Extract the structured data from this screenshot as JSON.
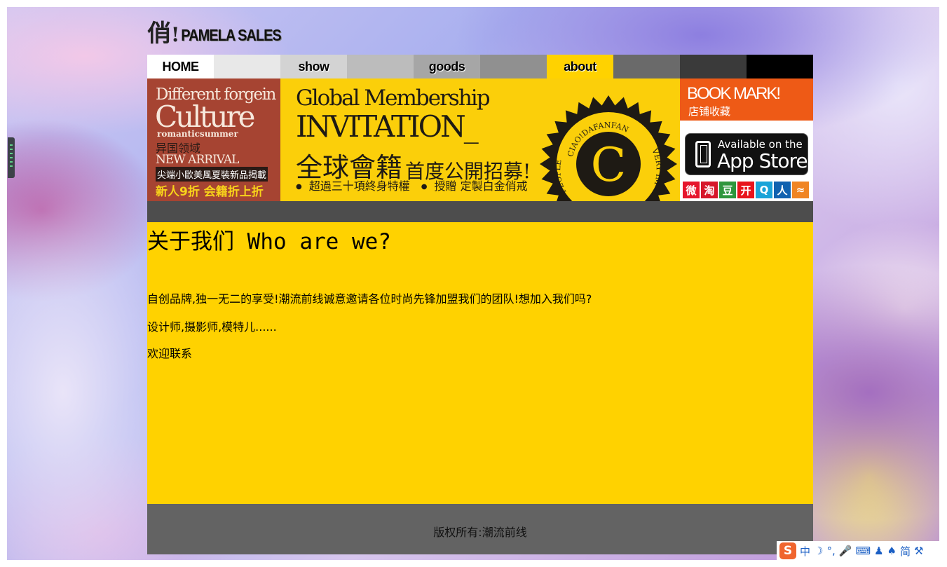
{
  "logo": {
    "char": "俏",
    "bang": "!",
    "text": "PAMELA SALES"
  },
  "nav": {
    "items": [
      {
        "label": "HOME",
        "bg": "#ffffff"
      },
      {
        "label": "",
        "bg": "#e8e8e8"
      },
      {
        "label": "show",
        "bg": "#d3d3d3"
      },
      {
        "label": "",
        "bg": "#bcbcbc"
      },
      {
        "label": "goods",
        "bg": "#a6a6a6"
      },
      {
        "label": "",
        "bg": "#909090"
      },
      {
        "label": "about",
        "bg": "#ffd200"
      },
      {
        "label": "",
        "bg": "#6a6a6a"
      },
      {
        "label": "",
        "bg": "#3a3a3a"
      },
      {
        "label": "",
        "bg": "#000000"
      }
    ]
  },
  "banner": {
    "left": {
      "line1": "Different forgein",
      "line2": "Culture",
      "line3": "romanticsummer",
      "line4": "异国领域",
      "line5": "NEW ARRIVAL",
      "line6": "尖端小歐美風夏裝新品揭載",
      "line7": "新人9折 会籍折上折"
    },
    "middle": {
      "line1": "Global Membership",
      "line2": "INVITATION_",
      "line3_big": "全球會籍",
      "line3_small": "首度公開招募!",
      "bullets": [
        "超過三十項終身特權",
        "授贈 定製白金俏戒"
      ],
      "seal": {
        "letter": "C",
        "top_text": "CIAO!DAFANFAN",
        "left_text": "PEOPLE",
        "right_text": "VERY IM"
      }
    },
    "right": {
      "bookmark_title": "BOOK MARK!",
      "bookmark_sub": "店铺收藏",
      "appstore_line1": "Available on the",
      "appstore_line2": "App Store",
      "socials": [
        {
          "name": "weibo-icon",
          "glyph": "微",
          "color": "#e6162d"
        },
        {
          "name": "taobao-icon",
          "glyph": "淘",
          "color": "#d6172a"
        },
        {
          "name": "douban-icon",
          "glyph": "豆",
          "color": "#2e963d"
        },
        {
          "name": "kaixin-icon",
          "glyph": "开",
          "color": "#e8141c"
        },
        {
          "name": "qq-icon",
          "glyph": "Q",
          "color": "#1aa3d8"
        },
        {
          "name": "renren-icon",
          "glyph": "人",
          "color": "#1062b0"
        },
        {
          "name": "rss-icon",
          "glyph": "≈",
          "color": "#f08524"
        }
      ]
    }
  },
  "content": {
    "heading": "关于我们 Who are we?",
    "para1": "自创品牌,独一无二的享受!潮流前线诚意邀请各位时尚先锋加盟我们的团队!想加入我们吗?",
    "para2": "设计师,摄影师,模特儿......",
    "para3": "欢迎联系"
  },
  "footer": {
    "text": "版权所有:潮流前线"
  },
  "ime": {
    "brand": "S",
    "items": [
      "中",
      "☽",
      "°,",
      "🎤",
      "⌨",
      "♟",
      "♠",
      "简",
      "⚒"
    ]
  }
}
